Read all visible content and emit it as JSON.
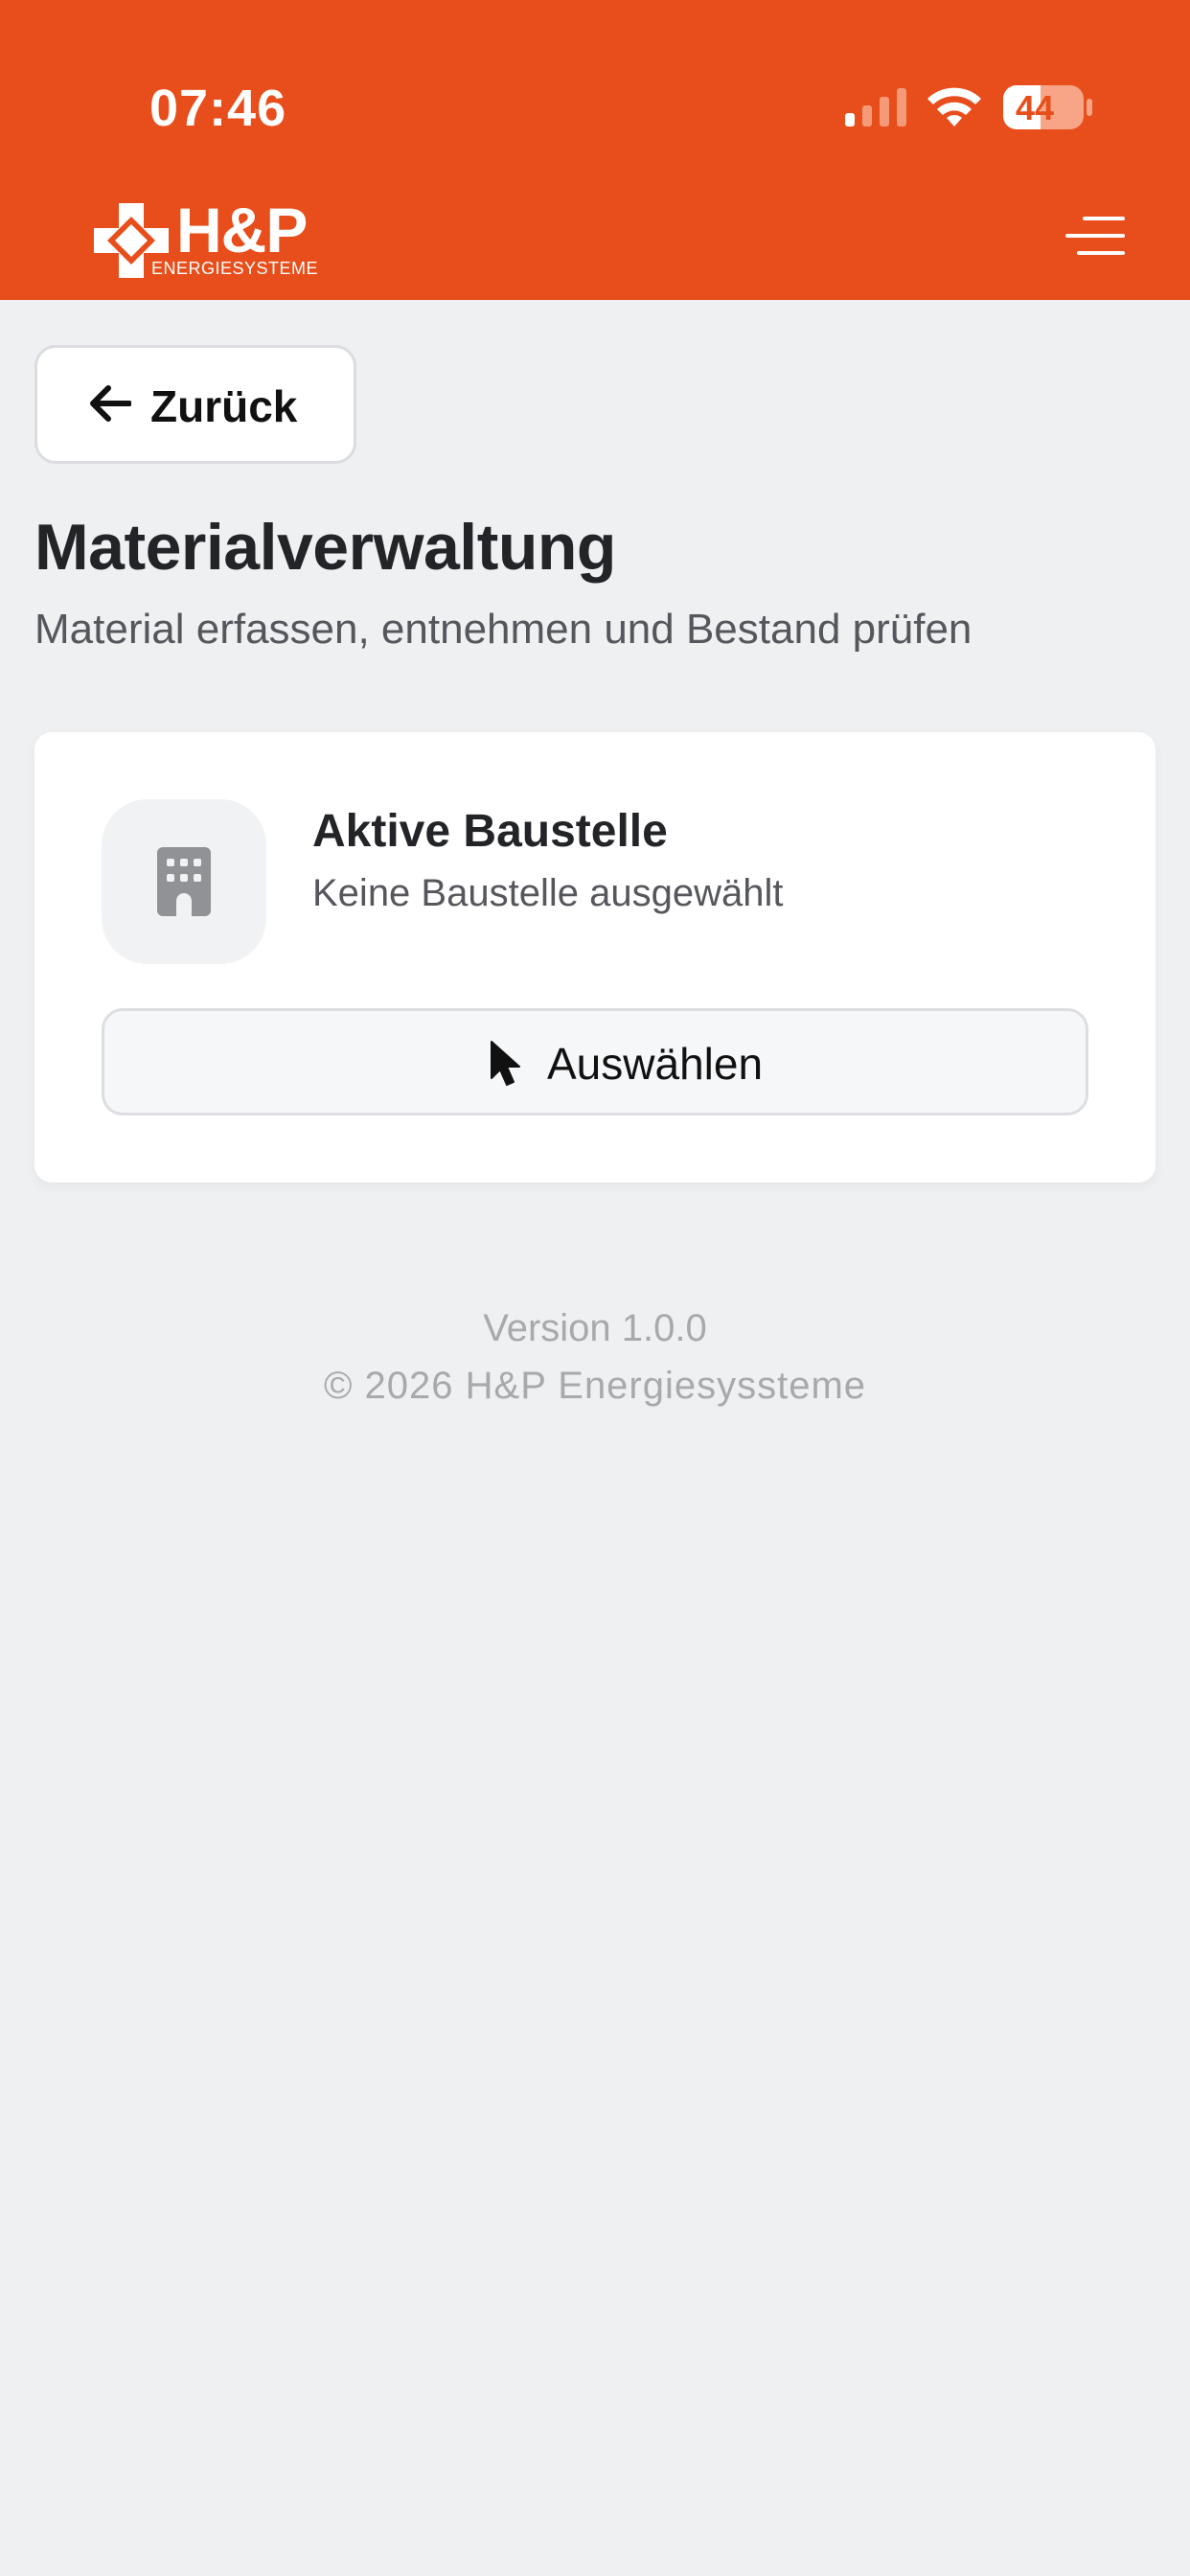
{
  "status_bar": {
    "time": "07:46",
    "battery_level": "44",
    "icons": [
      "cellular-signal-icon",
      "wifi-icon",
      "battery-icon"
    ]
  },
  "header": {
    "brand_name": "H&P",
    "brand_sub": "ENERGIESYSTEME",
    "menu_icon": "hamburger-menu-icon",
    "background_color": "#e84e1b"
  },
  "nav": {
    "back_label": "Zurück",
    "back_icon": "arrow-left-icon"
  },
  "page": {
    "title": "Materialverwaltung",
    "subtitle": "Material erfassen, entnehmen und Bestand prüfen"
  },
  "site_card": {
    "icon": "building-icon",
    "title": "Aktive Baustelle",
    "status": "Keine Baustelle ausgewählt",
    "select_icon": "cursor-pointer-icon",
    "select_label": "Auswählen"
  },
  "footer": {
    "version": "Version 1.0.0",
    "copyright": "© 2026 H&P Energiesyssteme"
  }
}
